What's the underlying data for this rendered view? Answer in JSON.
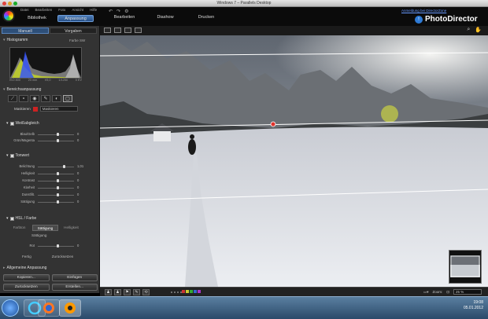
{
  "window": {
    "title": "Windows 7 – Parallels Desktop"
  },
  "menu": [
    "Datei",
    "Bearbeiten",
    "Foto",
    "Ansicht",
    "Hilfe"
  ],
  "app_tabs": [
    {
      "label": "Bibliothek"
    },
    {
      "label": "Anpassung"
    }
  ],
  "main_nav": [
    "Bearbeiten",
    "Diashow",
    "Drucken"
  ],
  "header": {
    "login_link": "Anmeldung bei DirectorZone",
    "product": "PhotoDirector"
  },
  "left": {
    "subtabs": [
      "Manuell",
      "Vorgaben"
    ],
    "histogram": {
      "title": "Histogramm",
      "mode_color": "Farbe",
      "mode_bw": "SW",
      "info": [
        "ISO 800",
        "23 mm",
        "f/5,0",
        "1/1250",
        "0 EV"
      ]
    },
    "region": {
      "title": "Bereichsanpassung"
    },
    "mask": {
      "label": "Maskieren",
      "value": "Maskieren"
    },
    "wb": {
      "title": "Weißabgleich",
      "sliders": [
        {
          "label": "Blau/Gelb",
          "pos": 0.55,
          "value": "0"
        },
        {
          "label": "Grün/Magenta",
          "pos": 0.55,
          "value": "0"
        }
      ]
    },
    "tone": {
      "title": "Tonwert",
      "sliders": [
        {
          "label": "Belichtung",
          "pos": 0.72,
          "value": "1,01"
        },
        {
          "label": "Helligkeit",
          "pos": 0.55,
          "value": "0"
        },
        {
          "label": "Kontrast",
          "pos": 0.55,
          "value": "0"
        },
        {
          "label": "Klarheit",
          "pos": 0.55,
          "value": "0"
        },
        {
          "label": "Dunstfilt.",
          "pos": 0.55,
          "value": "0"
        },
        {
          "label": "Sättigung",
          "pos": 0.55,
          "value": "0"
        }
      ]
    },
    "hsl": {
      "title": "HSL / Farbe",
      "tabs": [
        "Farbton",
        "Sättigung",
        "Helligkeit"
      ],
      "sub_title": "Sättigung",
      "sliders": [
        {
          "label": "Rot",
          "pos": 0.55,
          "value": "0"
        }
      ]
    },
    "links": [
      "Fertig",
      "Zurücksetzen"
    ],
    "general": {
      "title": "Allgemeine Anpassung"
    },
    "buttons": [
      "Kopieren...",
      "Einfügen",
      "Zurücksetzen",
      "Erstellen..."
    ]
  },
  "status": {
    "zoom_label": "Zoom:",
    "zoom_value": "25 %"
  },
  "taskbar": {
    "time": "19:08",
    "date": "05.01.2012"
  },
  "colors": {
    "accent": "#2e5a8f",
    "mask_swatch": "#cc2222"
  }
}
